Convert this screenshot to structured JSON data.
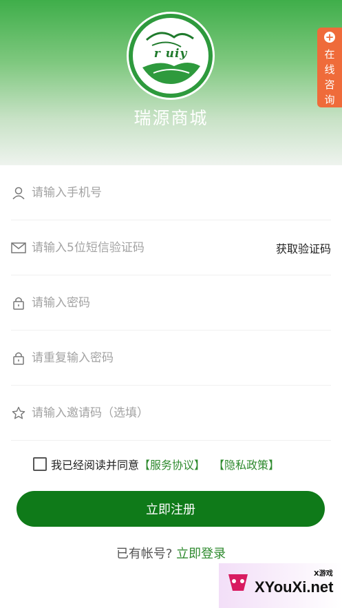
{
  "header": {
    "logo_text": "r uiy",
    "brand_name": "瑞源商城"
  },
  "consult": {
    "label": "在线咨询"
  },
  "form": {
    "phone_placeholder": "请输入手机号",
    "sms_placeholder": "请输入5位短信验证码",
    "sms_button": "获取验证码",
    "password_placeholder": "请输入密码",
    "repeat_password_placeholder": "请重复输入密码",
    "invite_placeholder": "请输入邀请码（选填）"
  },
  "agreement": {
    "prefix": "我已经阅读并同意",
    "service_link": "【服务协议】",
    "privacy_link": "【隐私政策】"
  },
  "register_button": "立即注册",
  "login": {
    "prompt": "已有帐号?",
    "link": "立即登录"
  },
  "watermark": {
    "small": "X游戏",
    "text": "XYouXi.net"
  },
  "colors": {
    "primary_green": "#0f7a19",
    "link_green": "#2e8a2e",
    "consult_orange": "#ef6b3a"
  }
}
